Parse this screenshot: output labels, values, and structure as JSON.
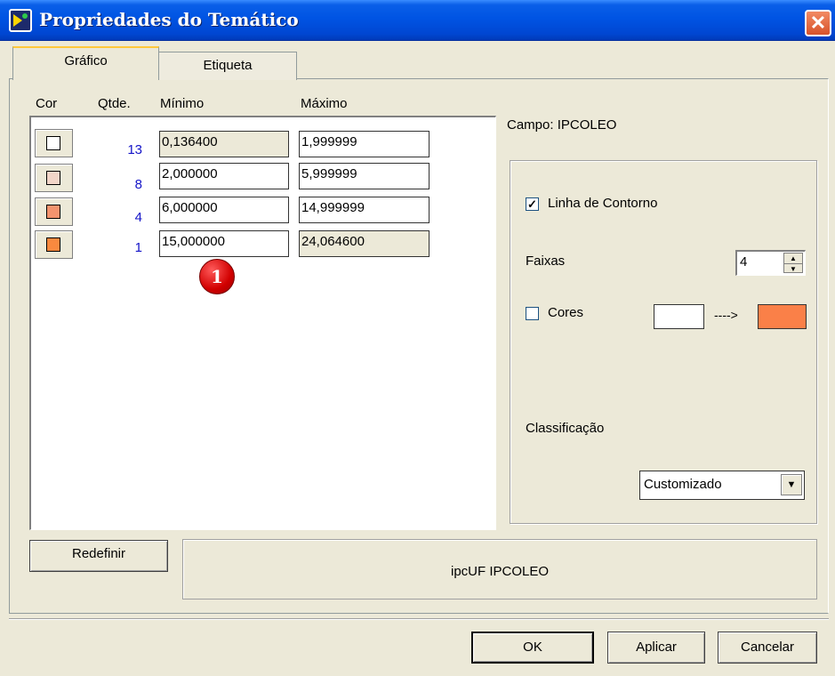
{
  "window": {
    "title": "Propriedades do Temático",
    "close_glyph": "✕"
  },
  "tabs": [
    {
      "label": "Gráfico",
      "active": true
    },
    {
      "label": "Etiqueta",
      "active": false
    }
  ],
  "columns": {
    "cor": "Cor",
    "qtde": "Qtde.",
    "minimo": "Mínimo",
    "maximo": "Máximo"
  },
  "rows": [
    {
      "color": "#FFFFFF",
      "qty": "13",
      "min": "0,136400",
      "max": "1,999999"
    },
    {
      "color": "#F2D5C8",
      "qty": "8",
      "min": "2,000000",
      "max": "5,999999"
    },
    {
      "color": "#F3936E",
      "qty": "4",
      "min": "6,000000",
      "max": "14,999999"
    },
    {
      "color": "#F9893F",
      "qty": "1",
      "min": "15,000000",
      "max": "24,064600"
    }
  ],
  "marker": {
    "label": "1"
  },
  "campo": "Campo: IPCOLEO",
  "options": {
    "linha_contorno": {
      "label": "Linha de Contorno",
      "checked": true,
      "check_glyph": "✓"
    },
    "faixas": {
      "label": "Faixas",
      "value": "4",
      "up": "▲",
      "down": "▼"
    },
    "cores": {
      "label": "Cores",
      "checked": false,
      "from_color": "#FFFFFF",
      "to_color": "#FA8048",
      "arrow": "---->"
    },
    "classificacao": {
      "label": "Classificação",
      "value": "Customizado",
      "dropdown_glyph": "▼"
    }
  },
  "buttons": {
    "redefinir": "Redefinir",
    "ok": "OK",
    "aplicar": "Aplicar",
    "cancelar": "Cancelar"
  },
  "info_text": "ipcUF IPCOLEO"
}
